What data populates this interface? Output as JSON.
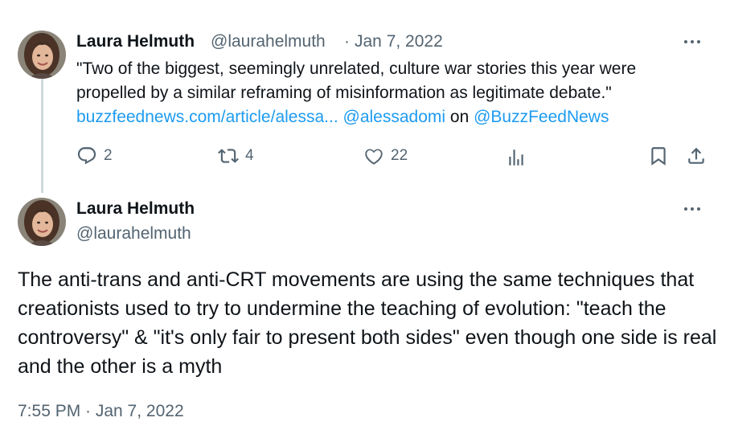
{
  "reply_tweet": {
    "author_name": "Laura Helmuth",
    "handle": "@laurahelmuth",
    "separator": "·",
    "date": "Jan 7, 2022",
    "text_line1": "\"Two of the biggest, seemingly unrelated, culture war stories this year were",
    "text_line2": "propelled by a similar reframing of misinformation as legitimate debate.\"",
    "link_url": "buzzfeednews.com/article/alessa...",
    "mention1": "@alessadomi",
    "on_word": "on",
    "mention2": "@BuzzFeedNews",
    "actions": {
      "reply_count": "2",
      "retweet_count": "4",
      "like_count": "22"
    }
  },
  "main_tweet": {
    "author_name": "Laura Helmuth",
    "handle": "@laurahelmuth",
    "text": "The anti-trans and anti-CRT movements are using the same techniques that creationists used to try to undermine the teaching of evolution: \"teach the controversy\" & \"it's only fair to present both sides\" even though one side is real and the other is a myth",
    "timestamp": "7:55 PM · Jan 7, 2022"
  },
  "icons": {
    "reply": "reply-icon",
    "retweet": "retweet-icon",
    "like": "heart-icon",
    "views": "analytics-icon",
    "bookmark": "bookmark-icon",
    "share": "share-icon",
    "more": "more-icon"
  },
  "colors": {
    "link": "#1d9bf0",
    "secondary_text": "#536471",
    "primary_text": "#0f1419",
    "thread_line": "#cfd9de"
  }
}
